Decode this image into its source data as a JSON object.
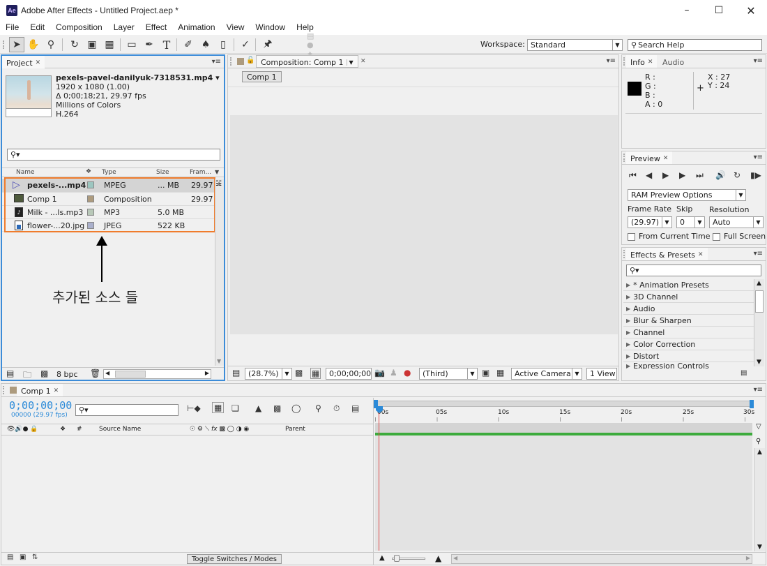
{
  "window": {
    "title": "Adobe After Effects - Untitled Project.aep *",
    "app_icon": "Ae"
  },
  "menu": [
    "File",
    "Edit",
    "Composition",
    "Layer",
    "Effect",
    "Animation",
    "View",
    "Window",
    "Help"
  ],
  "toolbar": {
    "workspace_label": "Workspace:",
    "workspace_value": "Standard",
    "search_help": "Search Help"
  },
  "project": {
    "tab": "Project",
    "footage": {
      "name": "pexels-pavel-danilyuk-7318531.mp4",
      "dims": "1920 x 1080 (1.00)",
      "duration": "Δ 0;00;18;21, 29.97 fps",
      "colors": "Millions of Colors",
      "codec": "H.264"
    },
    "columns": {
      "name": "Name",
      "type": "Type",
      "size": "Size",
      "frame": "Fram..."
    },
    "rows": [
      {
        "name": "pexels-...mp4",
        "type": "MPEG",
        "size": "... MB",
        "fps": "29.97",
        "color": "#9cc6c0"
      },
      {
        "name": "Comp 1",
        "type": "Composition",
        "size": "",
        "fps": "29.97",
        "color": "#ad9b7e"
      },
      {
        "name": "Milk - ...ls.mp3",
        "type": "MP3",
        "size": "5.0 MB",
        "fps": "",
        "color": "#b8c8b8"
      },
      {
        "name": "flower-...20.jpg",
        "type": "JPEG",
        "size": "522 KB",
        "fps": "",
        "color": "#aab0cc"
      }
    ],
    "bpc": "8 bpc",
    "annotation": "추가된 소스 들"
  },
  "composition": {
    "tab": "Composition: Comp 1",
    "breadcrumb": "Comp 1",
    "zoom": "(28.7%)",
    "timecode": "0;00;00;00",
    "resolution": "(Third)",
    "camera": "Active Camera",
    "views": "1 View"
  },
  "info": {
    "tab1": "Info",
    "tab2": "Audio",
    "r": "R :",
    "g": "G :",
    "b": "B :",
    "a": "A : 0",
    "x": "X : 27",
    "y": "Y : 24"
  },
  "preview": {
    "tab": "Preview",
    "ram_options": "RAM Preview Options",
    "frame_rate_label": "Frame Rate",
    "skip_label": "Skip",
    "resolution_label": "Resolution",
    "frame_rate": "(29.97)",
    "skip": "0",
    "resolution": "Auto",
    "from_current": "From Current Time",
    "full_screen": "Full Screen"
  },
  "effects": {
    "tab": "Effects & Presets",
    "items": [
      "* Animation Presets",
      "3D Channel",
      "Audio",
      "Blur & Sharpen",
      "Channel",
      "Color Correction",
      "Distort",
      "Expression Controls"
    ]
  },
  "timeline": {
    "tab": "Comp 1",
    "timecode": "0;00;00;00",
    "frames": "00000 (29.97 fps)",
    "col_source": "Source Name",
    "col_parent": "Parent",
    "col_hash": "#",
    "ruler": [
      "00s",
      "05s",
      "10s",
      "15s",
      "20s",
      "25s",
      "30s"
    ],
    "toggle": "Toggle Switches / Modes"
  }
}
